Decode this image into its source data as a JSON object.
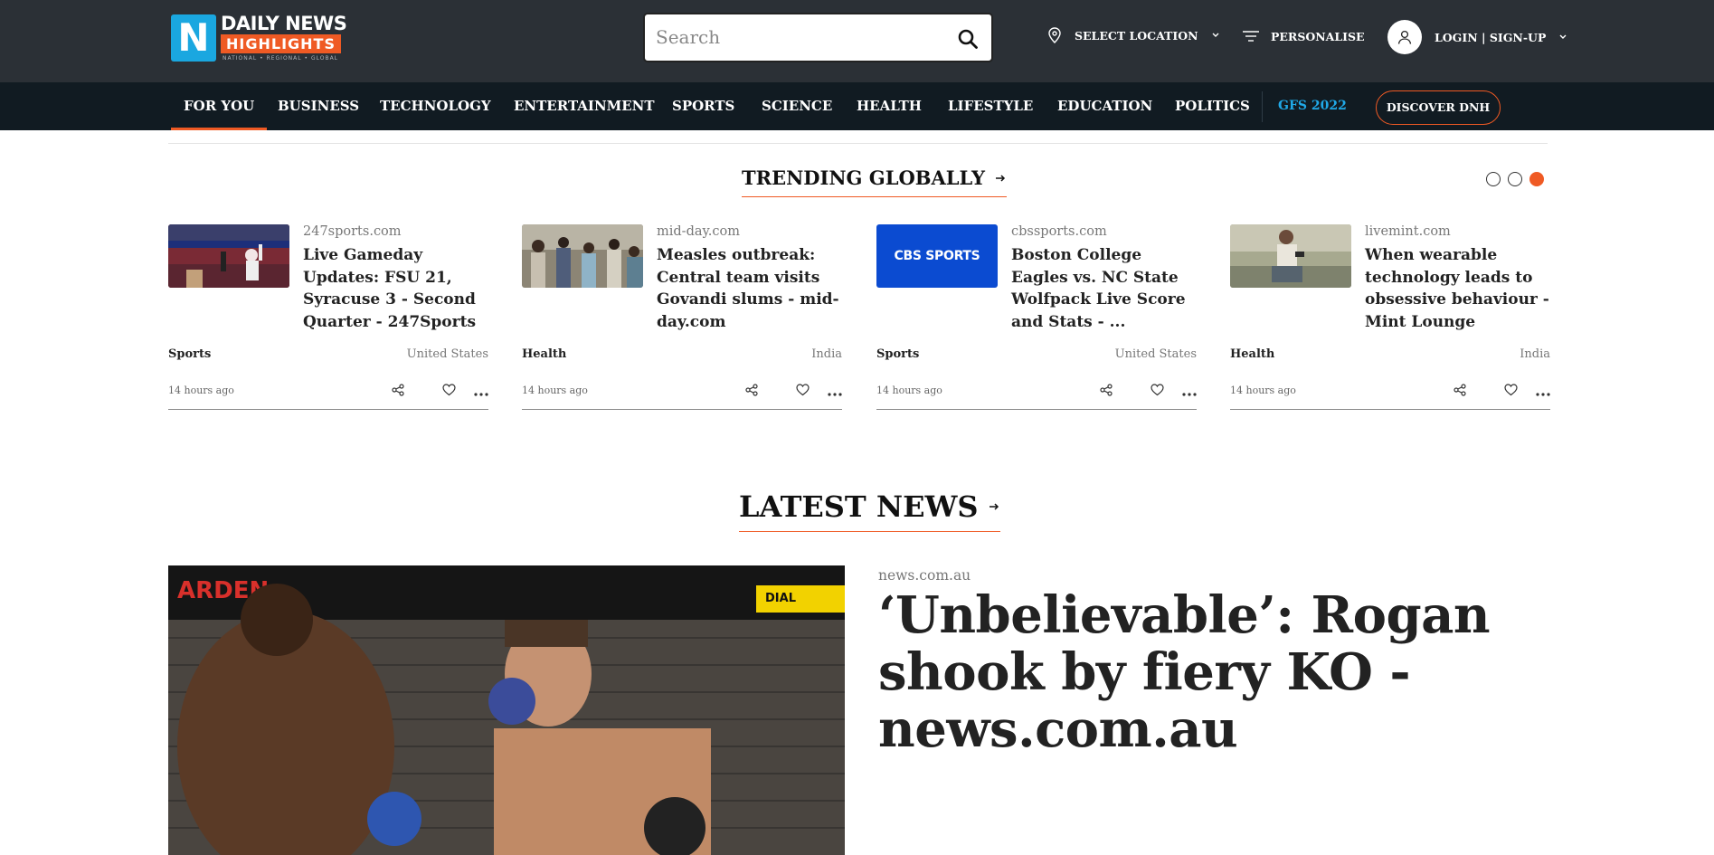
{
  "brand": {
    "line1": "DAILY NEWS",
    "line2": "HIGHLIGHTS",
    "tagline": "NATIONAL • REGIONAL • GLOBAL",
    "colors": {
      "header_bg": "#2b3036",
      "nav_bg": "#111b22",
      "accent": "#ef5a24",
      "blue": "#1aa7e0"
    }
  },
  "search": {
    "placeholder": "Search"
  },
  "header": {
    "location_label": "SELECT LOCATION",
    "personalise_label": "PERSONALISE",
    "login_label": "LOGIN | SIGN-UP"
  },
  "nav": {
    "items": [
      {
        "label": "FOR YOU",
        "active": true
      },
      {
        "label": "BUSINESS"
      },
      {
        "label": "TECHNOLOGY"
      },
      {
        "label": "ENTERTAINMENT"
      },
      {
        "label": "SPORTS"
      },
      {
        "label": "SCIENCE"
      },
      {
        "label": "HEALTH"
      },
      {
        "label": "LIFESTYLE"
      },
      {
        "label": "EDUCATION"
      },
      {
        "label": "POLITICS"
      },
      {
        "label": "GFS 2022"
      }
    ],
    "discover_label": "DISCOVER DNH"
  },
  "trending": {
    "title": "TRENDING GLOBALLY",
    "active_page": 3,
    "page_count": 3,
    "cards": [
      {
        "source": "247sports.com",
        "title": "Live Gameday Updates: FSU 21, Syracuse 3 - Second Quarter - 247Sports",
        "category": "Sports",
        "country": "United States",
        "time": "14 hours ago"
      },
      {
        "source": "mid-day.com",
        "title": "Measles outbreak: Central team visits Govandi slums - mid-day.com",
        "category": "Health",
        "country": "India",
        "time": "14 hours ago"
      },
      {
        "source": "cbssports.com",
        "title": "Boston College Eagles vs. NC State Wolfpack Live Score and Stats - ...",
        "category": "Sports",
        "country": "United States",
        "time": "14 hours ago",
        "thumb_text": "CBS SPORTS"
      },
      {
        "source": "livemint.com",
        "title": "When wearable technology leads to obsessive behaviour - Mint Lounge",
        "category": "Health",
        "country": "India",
        "time": "14 hours ago"
      }
    ]
  },
  "latest": {
    "title": "LATEST NEWS",
    "hero": {
      "source": "news.com.au",
      "title": "‘Unbelievable’: Rogan shook by fiery KO - news.com.au",
      "banner_text": "ARDEN",
      "sponsor_text": "DIAL"
    }
  }
}
